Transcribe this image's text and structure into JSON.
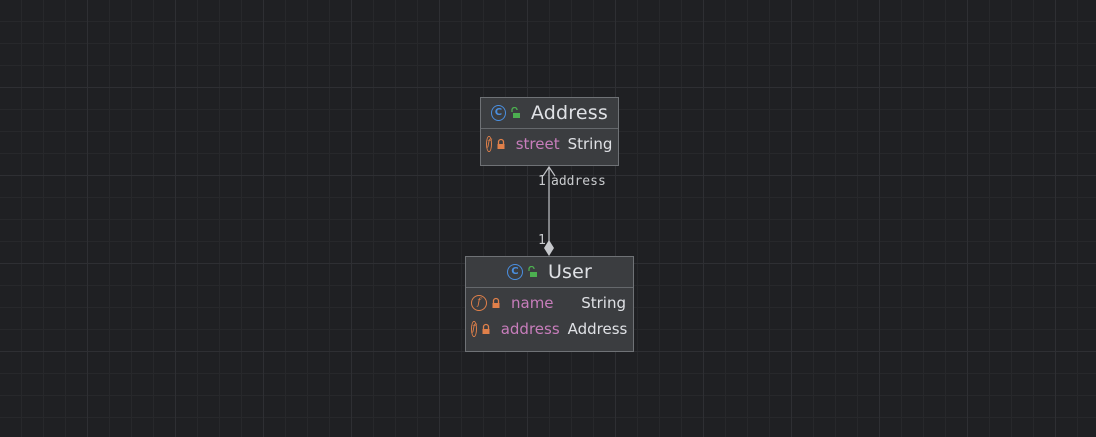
{
  "classes": {
    "address": {
      "name": "Address",
      "fields": [
        {
          "name": "street",
          "type": "String"
        }
      ]
    },
    "user": {
      "name": "User",
      "fields": [
        {
          "name": "name",
          "type": "String"
        },
        {
          "name": "address",
          "type": "Address"
        }
      ]
    }
  },
  "relation": {
    "target_multiplicity": "1",
    "target_role": "address",
    "source_multiplicity": "1"
  },
  "icons": {
    "class_icon": "class-c-icon",
    "field_icon": "field-f-icon",
    "public_visibility": "open-lock-icon",
    "private_visibility": "lock-icon"
  },
  "colors": {
    "background": "#1f2023",
    "class_icon": "#4a8fe0",
    "field_icon": "#e0804a",
    "field_name": "#c77dbb",
    "public_lock": "#4caf50",
    "private_lock": "#e0804a"
  }
}
